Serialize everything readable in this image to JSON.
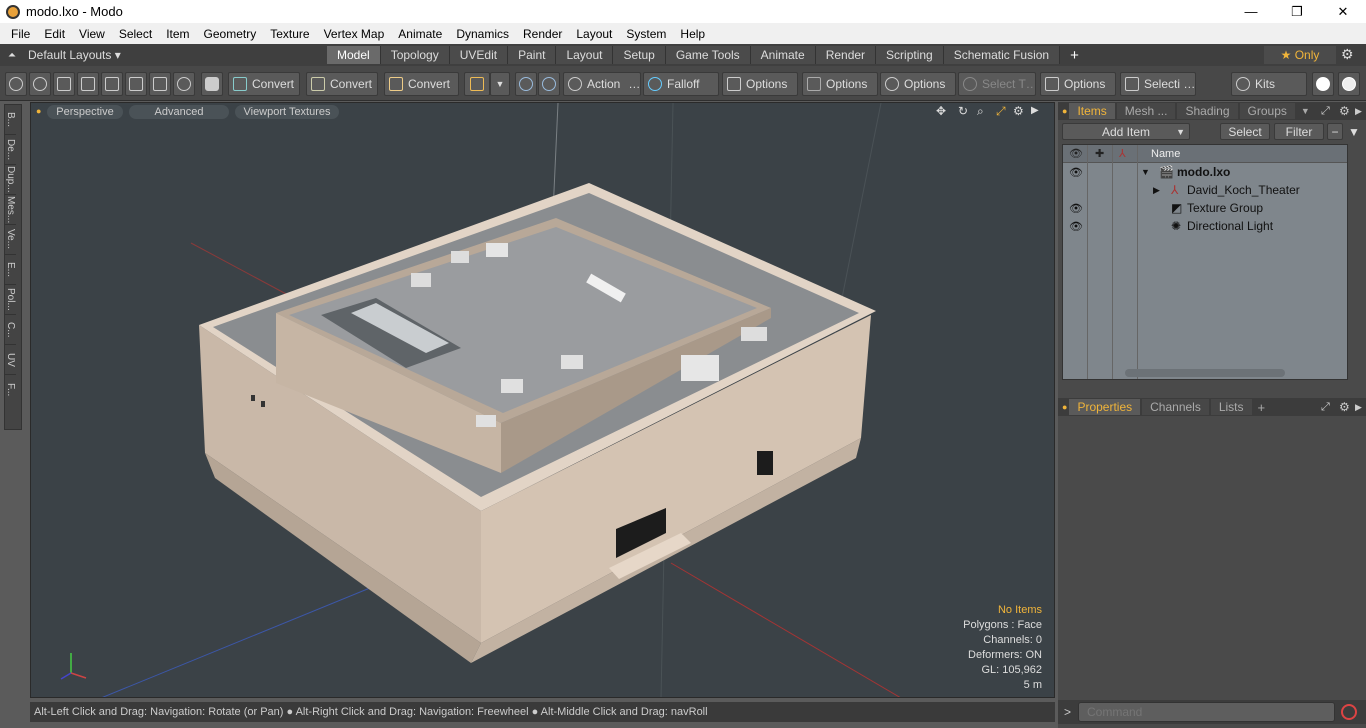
{
  "window": {
    "title": "modo.lxo - Modo",
    "minimize": "—",
    "maximize": "❐",
    "close": "✕"
  },
  "menu": [
    "File",
    "Edit",
    "View",
    "Select",
    "Item",
    "Geometry",
    "Texture",
    "Vertex Map",
    "Animate",
    "Dynamics",
    "Render",
    "Layout",
    "System",
    "Help"
  ],
  "layouts": {
    "selector": "Default Layouts ▾",
    "tabs": [
      "Model",
      "Topology",
      "UVEdit",
      "Paint",
      "Layout",
      "Setup",
      "Game Tools",
      "Animate",
      "Render",
      "Scripting",
      "Schematic Fusion"
    ],
    "active": "Model",
    "add": "+",
    "only": "★  Only",
    "gear": "⚙"
  },
  "toolbar": {
    "convert1": "Convert",
    "convert2": "Convert",
    "convert3": "Convert",
    "action": "Action",
    "action_more": "…",
    "falloff": "Falloff",
    "options1": "Options",
    "options2": "Options",
    "options3": "Options",
    "options4": "Options",
    "select_t": "Select T…",
    "selecti": "Selecti …",
    "kits": "Kits"
  },
  "left_tabs": [
    "B...",
    "De...",
    "Dup...",
    "Mes...",
    "Ve...",
    "E...",
    "Pol...",
    "C...",
    "UV",
    "F..."
  ],
  "viewport": {
    "perspective": "Perspective",
    "advanced": "Advanced",
    "textures": "Viewport Textures",
    "info": {
      "selection": "No Items",
      "polygons": "Polygons : Face",
      "channels": "Channels: 0",
      "deformers": "Deformers: ON",
      "gl": "GL: 105,962",
      "scale": "5 m"
    }
  },
  "status": "Alt-Left Click and Drag: Navigation: Rotate (or Pan) ● Alt-Right Click and Drag: Navigation: Freewheel ● Alt-Middle Click and Drag: navRoll",
  "items_panel": {
    "tabs": [
      "Items",
      "Mesh ...",
      "Shading",
      "Groups"
    ],
    "active": "Items",
    "add_item": "Add Item",
    "select": "Select",
    "filter": "Filter",
    "col_name": "Name",
    "rows": [
      {
        "label": "modo.lxo",
        "bold": true
      },
      {
        "label": "David_Koch_Theater"
      },
      {
        "label": "Texture Group"
      },
      {
        "label": "Directional Light"
      }
    ]
  },
  "props_panel": {
    "tabs": [
      "Properties",
      "Channels",
      "Lists"
    ],
    "active": "Properties",
    "add": "+"
  },
  "command": {
    "placeholder": "Command",
    "prompt": ">"
  }
}
